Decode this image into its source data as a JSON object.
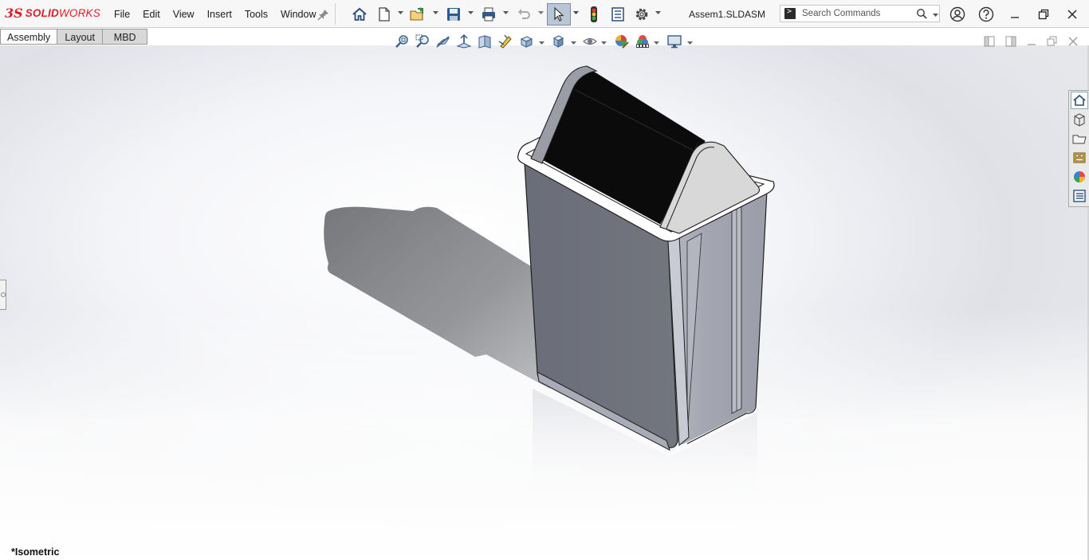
{
  "app": {
    "logo_mark": "3S",
    "logo_text_bold": "SOLID",
    "logo_text_light": "WORKS",
    "document_title": "Assem1.SLDASM"
  },
  "menu": {
    "items": [
      {
        "label": "File"
      },
      {
        "label": "Edit"
      },
      {
        "label": "View"
      },
      {
        "label": "Insert"
      },
      {
        "label": "Tools"
      },
      {
        "label": "Window"
      }
    ]
  },
  "toolbar": {
    "icons": [
      "home-icon",
      "new-document-icon",
      "open-icon",
      "save-icon",
      "print-icon",
      "undo-icon",
      "select-icon",
      "rebuild-icon",
      "file-properties-icon",
      "options-icon"
    ]
  },
  "search": {
    "placeholder": "Search Commands"
  },
  "tabs": [
    {
      "label": "Assembly",
      "active": true
    },
    {
      "label": "Layout",
      "active": false
    },
    {
      "label": "MBD",
      "active": false
    }
  ],
  "viewport": {
    "view_orientation": "*Isometric",
    "model": "swing-lid trash bin"
  },
  "colors": {
    "brand_red": "#da2128",
    "bin_front": "#6e717c",
    "bin_side": "#a7a9b5",
    "lid_dark": "#0b0b0b",
    "lid_cap": "#d6d6d6"
  },
  "taskpane": {
    "icons": [
      "solidworks-resources-icon",
      "design-library-icon",
      "file-explorer-icon",
      "view-palette-icon",
      "appearances-icon",
      "custom-properties-icon"
    ]
  }
}
